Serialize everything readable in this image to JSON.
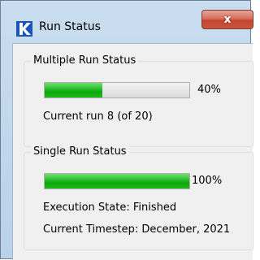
{
  "window": {
    "title": "Run Status",
    "close_symbol": "x",
    "icon": "app-logo-icon"
  },
  "multiple_run": {
    "title": "Multiple Run Status",
    "progress": 40,
    "progress_label": "40%",
    "current_run": "Current run 8 (of 20)"
  },
  "single_run": {
    "title": "Single Run Status",
    "progress": 100,
    "progress_label": "100%",
    "execution_state": "Execution State: Finished",
    "current_timestep": "Current Timestep: December, 2021"
  },
  "colors": {
    "progress_green": "#0ba80b",
    "close_red": "#c4452f",
    "title_bar": "#c9ddef"
  }
}
